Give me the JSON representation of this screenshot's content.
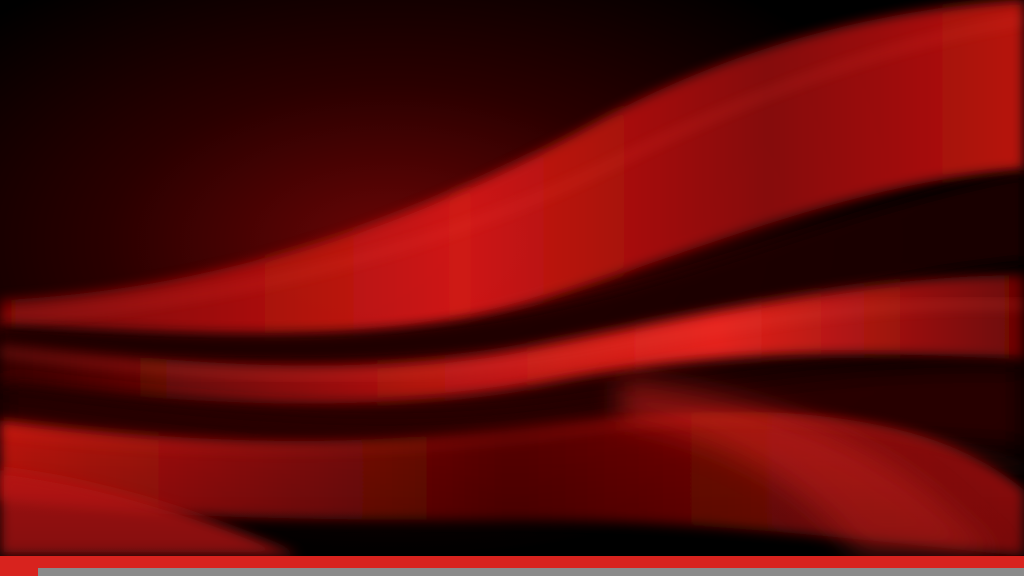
{
  "scene": {
    "description_icon": "red-silk-fabric-background",
    "colors": {
      "background": "#000000",
      "silk_deep": "#3a0000",
      "silk_mid": "#9e0a0a",
      "silk_bright": "#e3231c",
      "stripe": "#d8231e",
      "bar": "#8a8a8a"
    }
  }
}
